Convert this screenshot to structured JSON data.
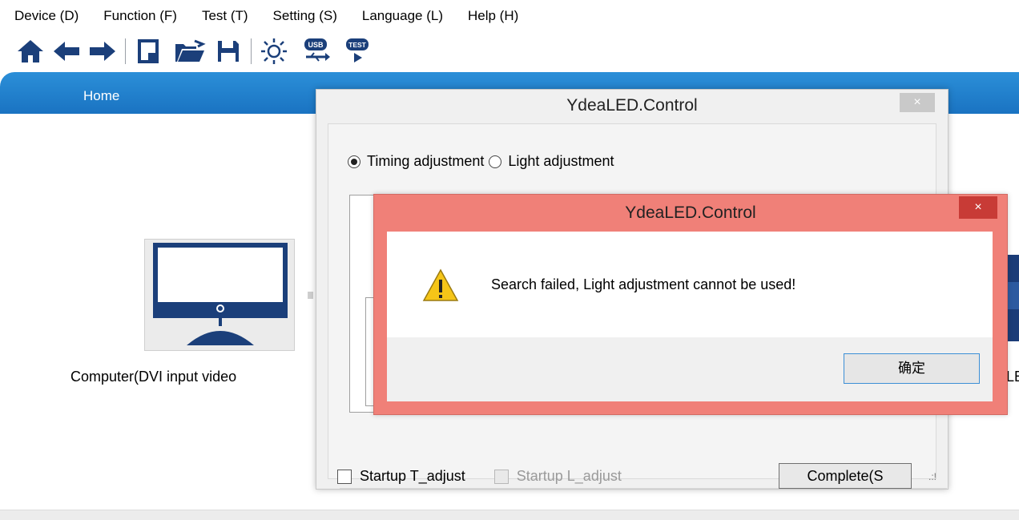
{
  "menu": [
    "Device (D)",
    "Function (F)",
    "Test (T)",
    "Setting (S)",
    "Language (L)",
    "Help (H)"
  ],
  "toolbar": {
    "icons": [
      "home-icon",
      "back-arrow-icon",
      "forward-arrow-icon",
      "new-file-icon",
      "open-folder-icon",
      "save-icon",
      "brightness-icon",
      "usb-icon",
      "test-icon"
    ],
    "usb_text": "USB",
    "test_text": "TEST"
  },
  "nav": {
    "home_tab": "Home"
  },
  "main": {
    "computer_label": "Computer(DVI input video",
    "right_label_fragment": "LE"
  },
  "dialog_control": {
    "title": "YdeaLED.Control",
    "close": "×",
    "radio_timing": "Timing adjustment",
    "radio_light": "Light adjustment",
    "startup_t": "Startup T_adjust",
    "startup_l": "Startup L_adjust",
    "complete_button": "Complete(S",
    "grip": ".:!"
  },
  "dialog_alert": {
    "title": "YdeaLED.Control",
    "close": "×",
    "message": "Search failed, Light adjustment cannot be used!",
    "ok_button": "确定"
  },
  "colors": {
    "accent": "#1a73c2",
    "alert_frame": "#f08078",
    "alert_close": "#c83b36",
    "icon_dark": "#1b3f7a"
  }
}
